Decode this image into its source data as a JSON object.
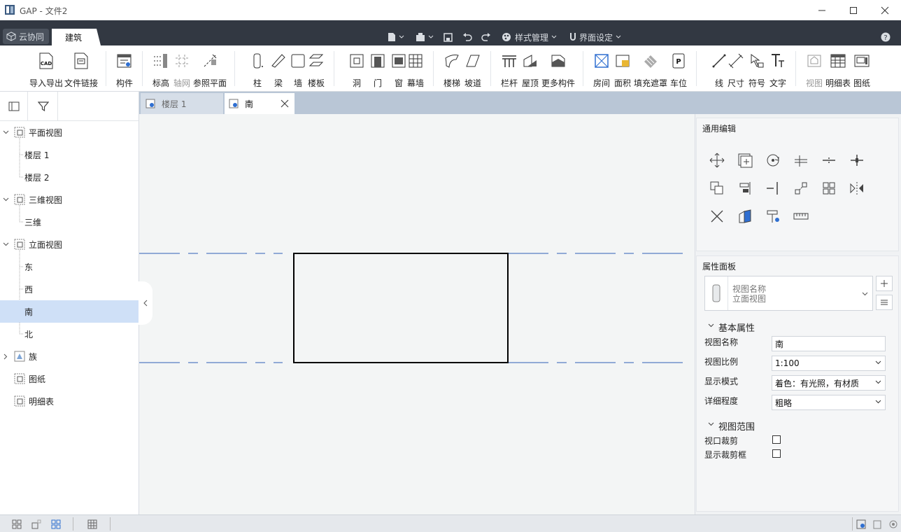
{
  "window": {
    "title": "GAP - 文件2"
  },
  "menubar": {
    "cloud_label": "云协同",
    "active_tab": "建筑",
    "style_mgmt": "样式管理",
    "ui_settings": "界面设定"
  },
  "ribbon": {
    "import_export": "导入导出",
    "file_link": "文件链接",
    "component": "构件",
    "level": "标高",
    "grid": "轴网",
    "ref_plane": "参照平面",
    "column": "柱",
    "beam": "梁",
    "wall": "墙",
    "slab": "楼板",
    "opening": "洞",
    "door": "门",
    "window": "窗",
    "curtain_wall": "幕墙",
    "stair": "楼梯",
    "ramp": "坡道",
    "railing": "栏杆",
    "roof": "屋顶",
    "more_components": "更多构件",
    "room": "房间",
    "area": "面积",
    "fill_mask": "填充遮罩",
    "parking": "车位",
    "line": "线",
    "dimension": "尺寸",
    "symbol": "符号",
    "text": "文字",
    "view": "视图",
    "schedule": "明细表",
    "sheet": "图纸"
  },
  "tree": {
    "plan_views": "平面视图",
    "level1": "楼层 1",
    "level2": "楼层 2",
    "views_3d": "三维视图",
    "view_3d": "三维",
    "elevation_views": "立面视图",
    "east": "东",
    "west": "西",
    "south": "南",
    "north": "北",
    "family": "族",
    "sheets": "图纸",
    "schedules": "明细表"
  },
  "tabs": {
    "tab1": "楼层 1",
    "tab2": "南"
  },
  "panel": {
    "general_edit": "通用编辑",
    "property_panel": "属性面板",
    "type_name_label": "视图名称",
    "type_name_value": "立面视图",
    "basic_props": "基本属性",
    "view_name_label": "视图名称",
    "view_name_value": "南",
    "view_scale_label": "视图比例",
    "view_scale_value": "1:100",
    "display_mode_label": "显示模式",
    "display_mode_value": "着色：有光照，有材质",
    "detail_level_label": "详细程度",
    "detail_level_value": "粗略",
    "view_range": "视图范围",
    "crop_view_label": "视口裁剪",
    "crop_box_label": "显示裁剪框"
  },
  "colors": {
    "menubar": "#323842",
    "selection": "#cfe0f7",
    "grid_line": "#2f5fb8",
    "tabstrip": "#b9c6d6"
  }
}
